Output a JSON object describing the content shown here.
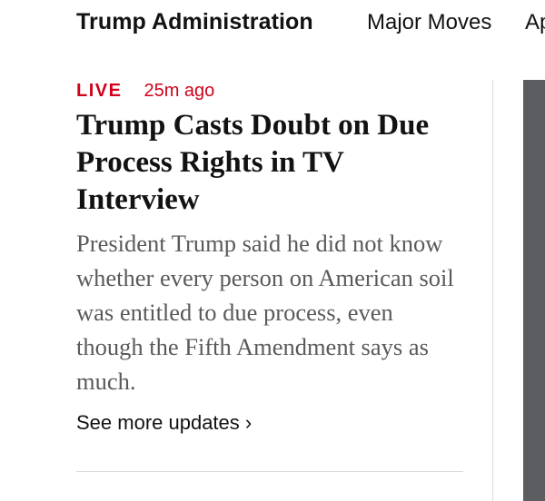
{
  "nav": {
    "section_title": "Trump Administration",
    "items": [
      {
        "label": "Major Moves"
      },
      {
        "label": "Ap"
      }
    ]
  },
  "story": {
    "live_label": "LIVE",
    "time_ago": "25m ago",
    "headline": "Trump Casts Doubt on Due Process Rights in TV Interview",
    "summary": "President Trump said he did not know whether every person on American soil was entitled to due process, even though the Fifth Amendment says as much.",
    "see_more": "See more updates ›"
  },
  "colors": {
    "live_red": "#d0021b",
    "text": "#121212",
    "summary_gray": "#5a5a5a",
    "divider": "#dcdcdc",
    "side_image": "#5b5d61"
  }
}
